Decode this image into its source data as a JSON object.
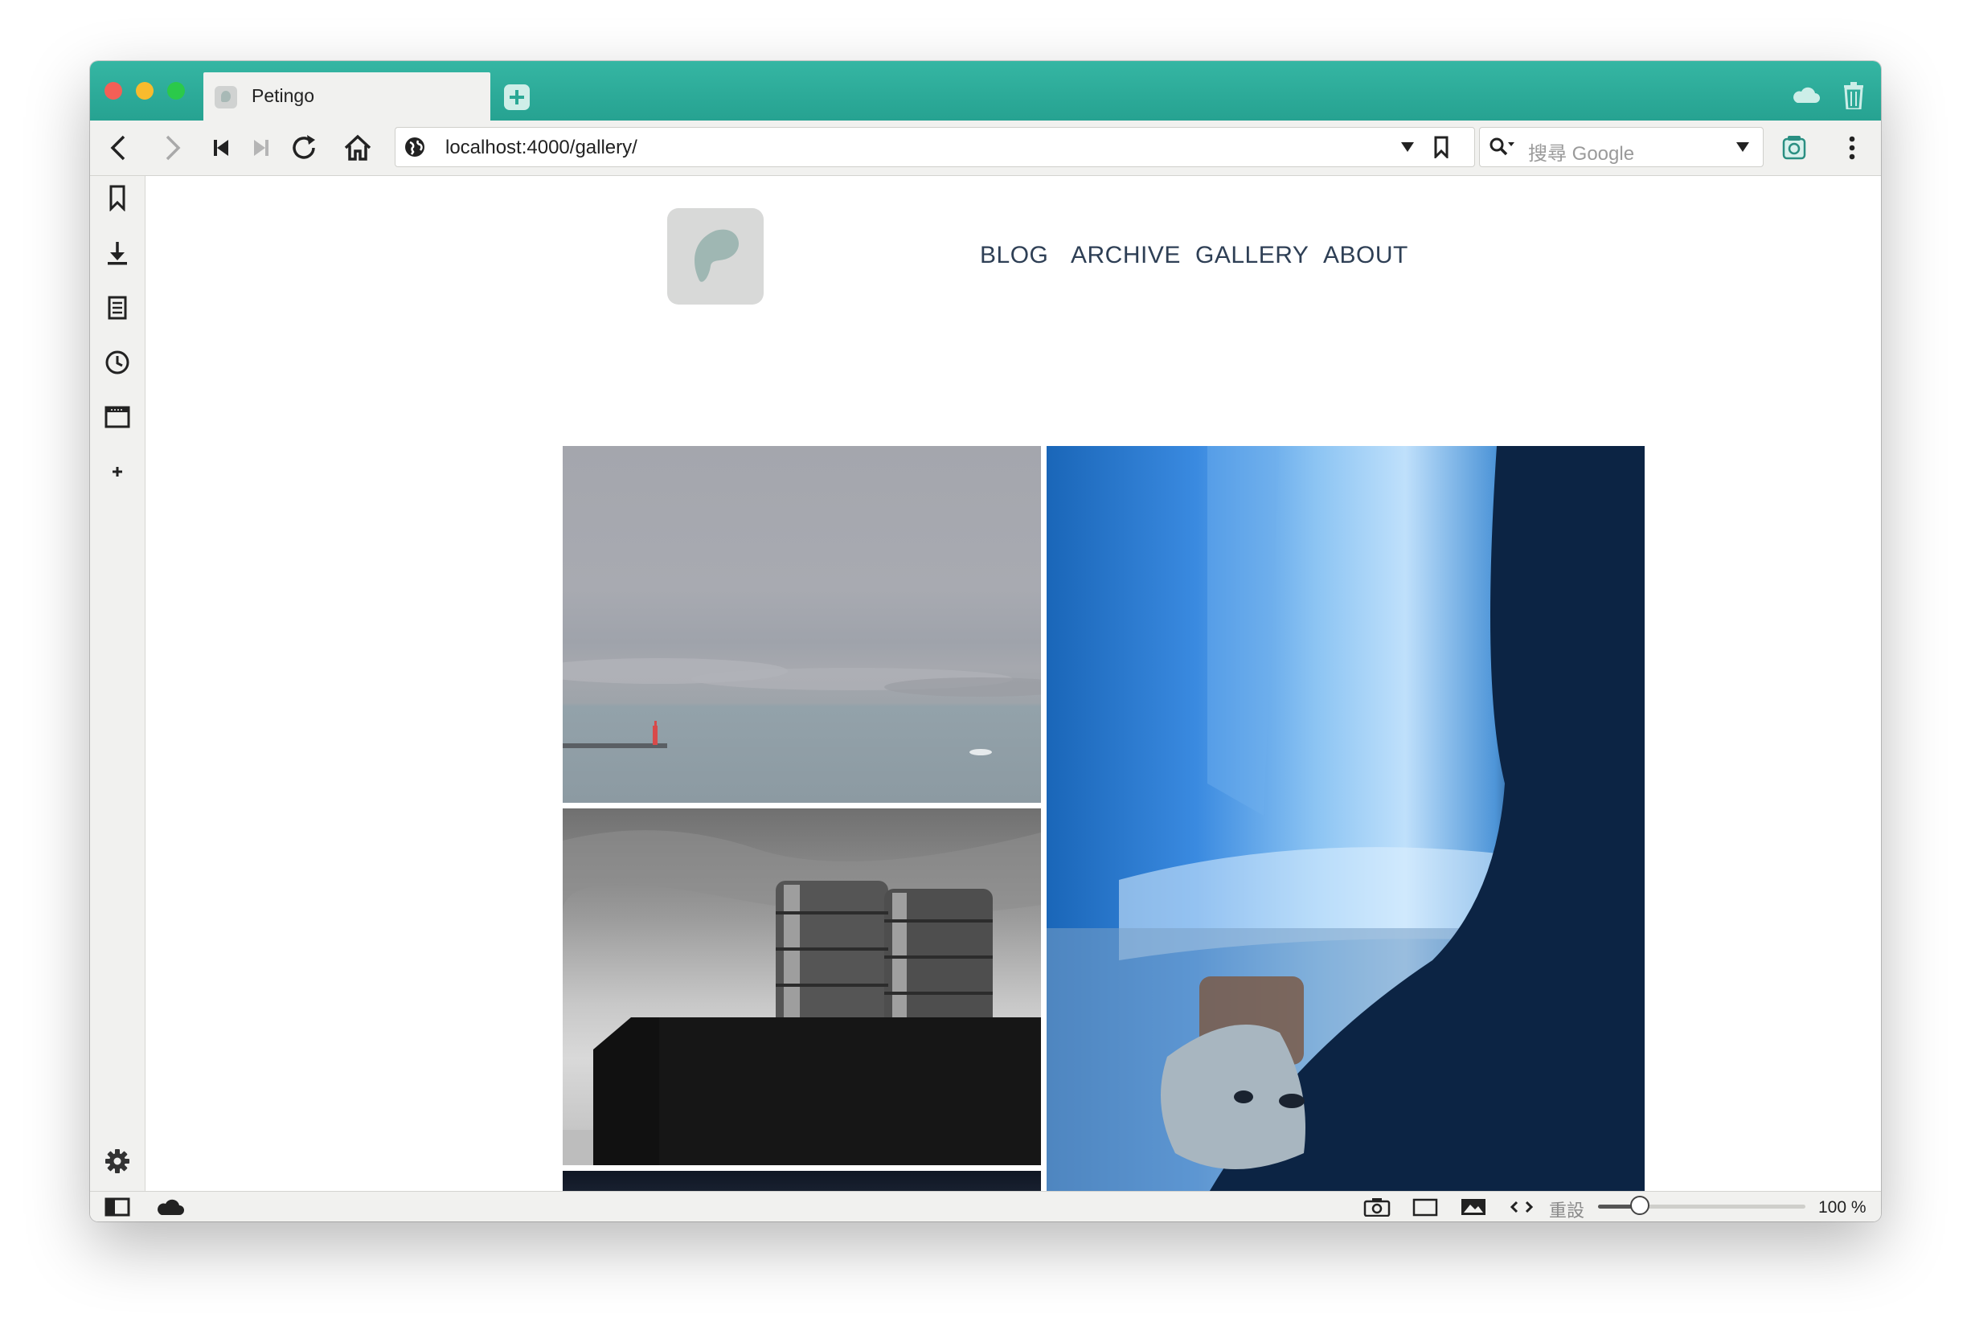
{
  "browser": {
    "tab": {
      "title": "Petingo",
      "favicon": "petingo-favicon"
    },
    "url": "localhost:4000/gallery/",
    "search": {
      "placeholder": "搜尋 Google",
      "engine_icon": "search-icon"
    },
    "toolbar_icons": [
      "back-icon",
      "forward-icon",
      "rewind-icon",
      "fast-forward-icon",
      "reload-icon",
      "home-icon",
      "globe-icon",
      "dropdown-icon",
      "bookmark-icon",
      "capture-icon",
      "menu-icon"
    ],
    "side_panel_icons": [
      "bookmarks-icon",
      "downloads-icon",
      "notes-icon",
      "history-icon",
      "window-icon",
      "add-panel-icon",
      "settings-icon"
    ],
    "status": {
      "reset_label": "重設",
      "zoom_label": "100 %",
      "zoom_level_percent": 100,
      "zoom_slider_fraction": 0.2
    },
    "colors": {
      "accent": "#2aa895",
      "chrome": "#f1f1ef",
      "nav_text": "#2e3f55"
    }
  },
  "site": {
    "nav": [
      "BLOG",
      "ARCHIVE",
      "GALLERY",
      "ABOUT"
    ],
    "gallery": [
      "sea-lighthouse-photo",
      "water-tanks-photo",
      "night-sky-photo",
      "girl-with-cat-photo"
    ]
  }
}
